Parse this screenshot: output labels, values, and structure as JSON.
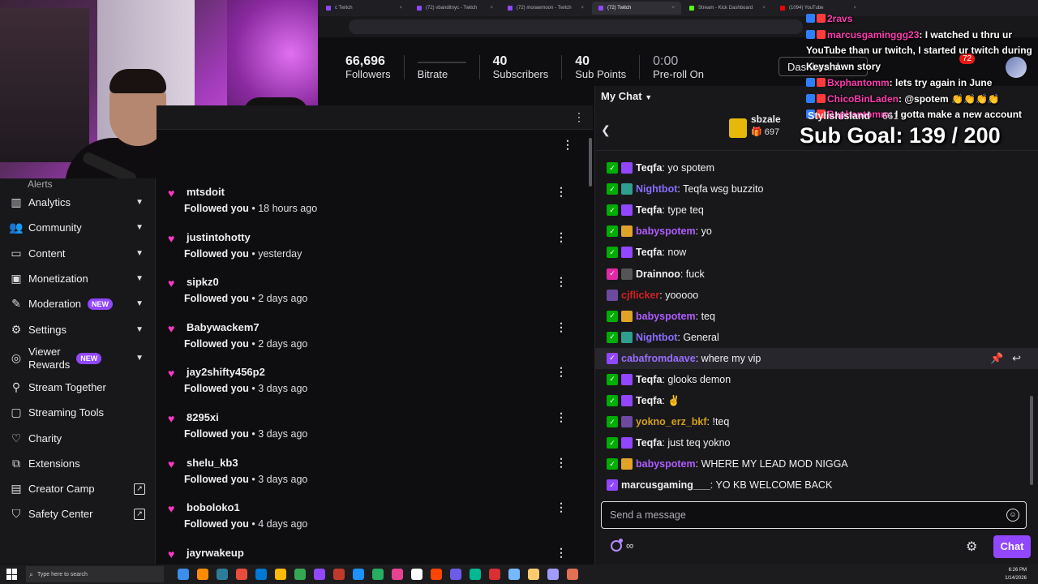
{
  "browser": {
    "tabs": [
      {
        "label": "c Twitch",
        "color": "#9147ff",
        "active": false
      },
      {
        "label": "(72) vbanditnyc - Twitch",
        "color": "#9147ff",
        "active": false
      },
      {
        "label": "(72) morawmoon - Twitch",
        "color": "#9147ff",
        "active": false
      },
      {
        "label": "(72) Twitch",
        "color": "#9147ff",
        "active": true
      },
      {
        "label": "Stream - Kick Dashboard",
        "color": "#53fc18",
        "active": false
      },
      {
        "label": "(1094) YouTube",
        "color": "#ff0000",
        "active": false
      }
    ]
  },
  "stats": {
    "followers_value": "66,696",
    "followers_label": "Followers",
    "bitrate_label": "Bitrate",
    "subscribers_value": "40",
    "subscribers_label": "Subscribers",
    "subpoints_value": "40",
    "subpoints_label": "Sub Points",
    "preroll_value": "0:00",
    "preroll_label": "Pre-roll On",
    "dashboard_label": "Dashboard",
    "notification_count": "72"
  },
  "sidebar": {
    "partial_label": "Alerts",
    "items": [
      {
        "label": "Analytics",
        "icon": "analytics-icon",
        "glyph": "▥",
        "chevron": true
      },
      {
        "label": "Community",
        "icon": "community-icon",
        "glyph": "👥",
        "chevron": true
      },
      {
        "label": "Content",
        "icon": "content-icon",
        "glyph": "▭",
        "chevron": true
      },
      {
        "label": "Monetization",
        "icon": "monetization-icon",
        "glyph": "▣",
        "chevron": true
      },
      {
        "label": "Moderation",
        "icon": "moderation-icon",
        "glyph": "✎",
        "chevron": true,
        "badge": "NEW"
      },
      {
        "label": "Settings",
        "icon": "settings-icon",
        "glyph": "⚙",
        "chevron": true
      },
      {
        "label": "Viewer Rewards",
        "icon": "viewer-rewards-icon",
        "glyph": "◎",
        "chevron": true,
        "badge": "NEW"
      },
      {
        "label": "Stream Together",
        "icon": "stream-together-icon",
        "glyph": "⚲"
      },
      {
        "label": "Streaming Tools",
        "icon": "streaming-tools-icon",
        "glyph": "▢"
      },
      {
        "label": "Charity",
        "icon": "charity-icon",
        "glyph": "♡"
      },
      {
        "label": "Extensions",
        "icon": "extensions-icon",
        "glyph": "⧉"
      },
      {
        "label": "Creator Camp",
        "icon": "creator-camp-icon",
        "glyph": "▤",
        "external": true
      },
      {
        "label": "Safety Center",
        "icon": "safety-center-icon",
        "glyph": "⛉",
        "external": true
      }
    ]
  },
  "followers": {
    "action": "Followed you",
    "items": [
      {
        "name": "mtsdoit",
        "time": "18 hours ago"
      },
      {
        "name": "justintohotty",
        "time": "yesterday"
      },
      {
        "name": "sipkz0",
        "time": "2 days ago"
      },
      {
        "name": "Babywackem7",
        "time": "2 days ago"
      },
      {
        "name": "jay2shifty456p2",
        "time": "3 days ago"
      },
      {
        "name": "8295xi",
        "time": "3 days ago"
      },
      {
        "name": "shelu_kb3",
        "time": "3 days ago"
      },
      {
        "name": "boboloko1",
        "time": "4 days ago"
      },
      {
        "name": "jayrwakeup",
        "time": ""
      }
    ]
  },
  "chat": {
    "title": "My Chat",
    "top_user": "sbzale",
    "top_count": "697",
    "messages": [
      {
        "user": "Teqfa",
        "text": ": yo spotem",
        "color": "#efeff1",
        "b1": "#00ad03",
        "b2": "#9147ff"
      },
      {
        "user": "Nightbot",
        "text": ": Teqfa wsg buzzito",
        "color": "#8a6dff",
        "b1": "#00ad03",
        "b2": "#2f9e8f"
      },
      {
        "user": "Teqfa",
        "text": ": type teq",
        "color": "#efeff1",
        "b1": "#00ad03",
        "b2": "#9147ff"
      },
      {
        "user": "babyspotem",
        "text": ": yo",
        "color": "#b05cff",
        "b1": "#00ad03",
        "b2": "#e0a32a"
      },
      {
        "user": "Teqfa",
        "text": ": now",
        "color": "#efeff1",
        "b1": "#00ad03",
        "b2": "#9147ff"
      },
      {
        "user": "Drainnoo",
        "text": ": fuck",
        "color": "#efeff1",
        "b1": "#e02aa6",
        "b2": "#555"
      },
      {
        "user": "cjflicker",
        "text": ": yooooo",
        "color": "#d42020",
        "b1": "",
        "b2": "#6b4aa0"
      },
      {
        "user": "babyspotem",
        "text": ": teq",
        "color": "#b05cff",
        "b1": "#00ad03",
        "b2": "#e0a32a"
      },
      {
        "user": "Nightbot",
        "text": ": General",
        "color": "#8a6dff",
        "b1": "#00ad03",
        "b2": "#2f9e8f"
      },
      {
        "user": "cabafromdaave",
        "text": ": where my vip",
        "color": "#9a6dff",
        "b1": "#9147ff",
        "b2": "",
        "highlight": true
      },
      {
        "user": "Teqfa",
        "text": ": glooks demon",
        "color": "#efeff1",
        "b1": "#00ad03",
        "b2": "#9147ff"
      },
      {
        "user": "Teqfa",
        "text": ": ✌",
        "color": "#efeff1",
        "b1": "#00ad03",
        "b2": "#9147ff"
      },
      {
        "user": "yokno_erz_bkf",
        "text": ": !teq",
        "color": "#d4a017",
        "b1": "#00ad03",
        "b2": "#6b4aa0"
      },
      {
        "user": "Teqfa",
        "text": ": just teq yokno",
        "color": "#efeff1",
        "b1": "#00ad03",
        "b2": "#9147ff"
      },
      {
        "user": "babyspotem",
        "text": ": WHERE MY LEAD MOD NIGGA",
        "color": "#b05cff",
        "b1": "#00ad03",
        "b2": "#e0a32a"
      },
      {
        "user": "marcusgaming___",
        "text": ": YO KB WELCOME BACK",
        "color": "#efeff1",
        "b1": "#9147ff",
        "b2": ""
      }
    ],
    "input_placeholder": "Send a message",
    "points_value": "∞",
    "chat_button": "Chat"
  },
  "overlay": {
    "lines": [
      {
        "user": "2ravs",
        "text": ""
      },
      {
        "user": "marcusgaminggg23",
        "text": ": I watched u thru ur YouTube than ur twitch, I started ur twitch during Keyshawn story"
      },
      {
        "user": "Bxphantomm",
        "text": ": lets try again in June"
      },
      {
        "user": "ChicoBinLaden",
        "text": ": @spotem 👏👏👏👏"
      },
      {
        "user": "Bxphantomm",
        "text": ": I gotta make a new account"
      }
    ],
    "stylish_name": "Stylishisland",
    "stylish_count": "661",
    "sub_goal": "Sub Goal:  139 / 200"
  },
  "taskbar": {
    "search_placeholder": "Type here to search",
    "time": "6:26 PM",
    "date": "1/14/2026"
  }
}
